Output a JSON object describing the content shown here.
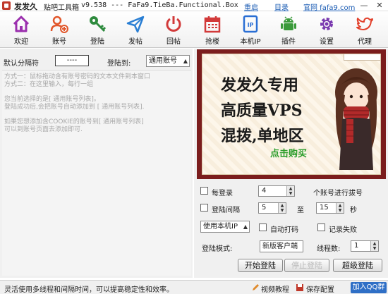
{
  "window": {
    "title": "发发久",
    "subtitle": "贴吧工具箱",
    "version": "v9.538 --- FaFa9.TieBa.Functional.Box",
    "links": {
      "restart": "重启",
      "dir": "目录",
      "website": "官网 fafa9.com"
    },
    "controls": {
      "minimize": "—",
      "close": "✕"
    }
  },
  "toolbar": [
    {
      "label": "欢迎",
      "icon": "home-icon",
      "color": "#9b2fae"
    },
    {
      "label": "账号",
      "icon": "add-user-icon",
      "color": "#e2572b"
    },
    {
      "label": "登陆",
      "icon": "key-icon",
      "color": "#2e8b3e"
    },
    {
      "label": "发帖",
      "icon": "send-icon",
      "color": "#2a7fd4"
    },
    {
      "label": "回帖",
      "icon": "power-icon",
      "color": "#d23a3a"
    },
    {
      "label": "抢楼",
      "icon": "calendar-icon",
      "color": "#d23a3a"
    },
    {
      "label": "本机IP",
      "icon": "ip-icon",
      "color": "#2a6fd4"
    },
    {
      "label": "插件",
      "icon": "android-icon",
      "color": "#3a9a3a"
    },
    {
      "label": "设置",
      "icon": "gear-icon",
      "color": "#7a3ab0"
    },
    {
      "label": "代理",
      "icon": "twitter-icon",
      "color": "#e2402b"
    }
  ],
  "left_panel": {
    "delimiter_label": "默认分隔符",
    "delimiter_value": "----",
    "login_to_label": "登陆到:",
    "account_list_select": "通用账号",
    "hints": [
      "方式一：鼠标拖动含有账号密码的文本文件到本窗口",
      "方式二：在这里输入，每行一组",
      "您当前选择的是[ 通用账号列表]。",
      "登陆成功后,会把账号自动添加到 [ 通用账号列表].",
      "如果您想添加含COOKIE的账号到[ 通用账号列表]",
      "可以到账号页面去添加即可."
    ]
  },
  "ad": {
    "line1": "发发久专用",
    "line2": "高质量VPS",
    "line3": "混拨,单地区",
    "cta": "点击购买"
  },
  "options": {
    "per_login_label": "每登录",
    "per_login_value": "4",
    "per_login_suffix": "个账号进行拔号",
    "interval_label": "登陆间隔",
    "interval_min": "5",
    "interval_to": "至",
    "interval_max": "15",
    "interval_unit": "秒",
    "ip_select": "使用本机IP",
    "auto_captcha_label": "自动打码",
    "record_fail_label": "记录失败",
    "mode_label": "登陆模式:",
    "mode_select": "新版客户端",
    "threads_label": "线程数:",
    "threads_value": "1",
    "start_button": "开始登陆",
    "stop_button": "停止登陆",
    "super_button": "超级登陆"
  },
  "status": {
    "text": "灵活使用多线程和间隔时间，可以提高稳定性和效率。",
    "video_link": "视频教程",
    "save_link": "保存配置",
    "qq_button": "加入QQ群"
  }
}
